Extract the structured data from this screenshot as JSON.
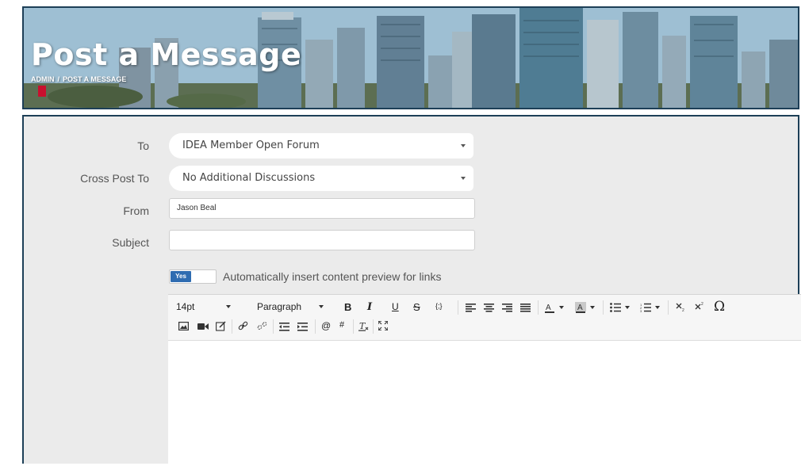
{
  "banner": {
    "title": "Post a Message",
    "breadcrumb": [
      "ADMIN",
      "POST A MESSAGE"
    ],
    "separator": "/"
  },
  "form": {
    "to": {
      "label": "To",
      "value": "IDEA Member Open Forum"
    },
    "cross_post": {
      "label": "Cross Post To",
      "value": "No Additional Discussions"
    },
    "from": {
      "label": "From",
      "value": "Jason Beal"
    },
    "subject": {
      "label": "Subject",
      "value": "",
      "placeholder": ""
    },
    "preview_toggle": {
      "state_label": "Yes",
      "label": "Automatically insert content preview for links"
    }
  },
  "editor": {
    "font_size": "14pt",
    "block_format": "Paragraph",
    "tools": {
      "bold": "B",
      "italic": "I",
      "underline": "U",
      "strikethrough": "S",
      "code": "{;}",
      "mention": "@",
      "hashtag": "#",
      "special_char": "Ω"
    },
    "content": ""
  },
  "colors": {
    "border": "#1d3f57",
    "panel_bg": "#ebebeb",
    "toggle_on": "#2f6cb1"
  }
}
